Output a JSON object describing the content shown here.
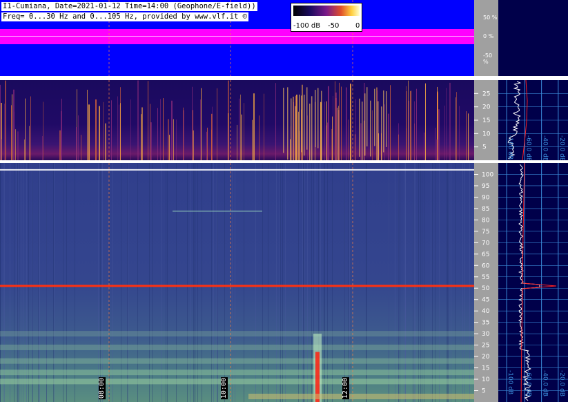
{
  "header": {
    "line1": "I1-Cumiana, Date=2021-01-12 Time=14:00 (Geophone/E-field))",
    "line2": "Freq= 0...30 Hz and 0...105 Hz, provided by www.vlf.it ©"
  },
  "colorbar": {
    "tick_labels": [
      "-100 dB",
      "-50",
      "0"
    ],
    "range_db": [
      -100,
      0
    ]
  },
  "waveform_axis": {
    "tick_labels": [
      "50 %",
      "0 %",
      "-50 %"
    ],
    "ticks": [
      50,
      0,
      -50
    ],
    "range": [
      -100,
      100
    ]
  },
  "colors": {
    "waveform_background": "#0000ff",
    "waveform_trace": "#ff00ff",
    "axis_panel": "#a0a0a0",
    "profile_background": "#00004a",
    "profile_trace": "#ffffff",
    "peak_trace": "#ff2020",
    "grid": "#3a8ad8",
    "hour_marker": "#ff8040"
  },
  "chart_data": [
    {
      "type": "heatmap",
      "panel": "low-frequency spectrogram",
      "y_range": [
        0,
        30
      ],
      "y_ticks": [
        5,
        10,
        15,
        20,
        25
      ],
      "x_hour_markers": [
        "08:00",
        "10:00",
        "12:00"
      ],
      "profile_axis_labels": [
        "-100 dB",
        "-60.0 dB",
        "-40.0 dB",
        "-20.0 dB"
      ]
    },
    {
      "type": "heatmap",
      "panel": "extended-frequency spectrogram",
      "y_range": [
        0,
        105
      ],
      "y_ticks": [
        5,
        10,
        15,
        20,
        25,
        30,
        35,
        40,
        45,
        50,
        55,
        60,
        65,
        70,
        75,
        80,
        85,
        90,
        95,
        100
      ],
      "x_hour_markers": [
        "08:00",
        "10:00",
        "12:00"
      ],
      "hour_labels": [
        "08:00",
        "10:00",
        "12:00"
      ],
      "profile_axis_labels": [
        "-100 dB",
        "-60.0 dB",
        "-40.0 dB",
        "-20.0 dB"
      ],
      "profile_peak_hz": 51
    }
  ]
}
